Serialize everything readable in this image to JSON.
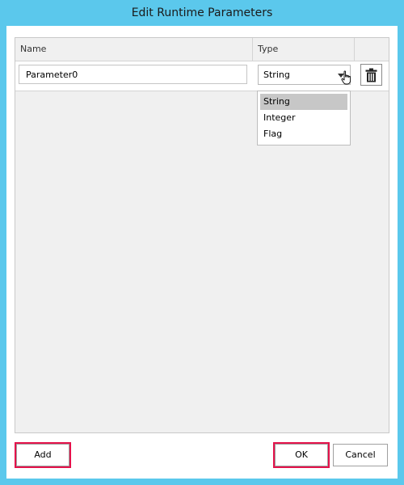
{
  "window": {
    "title": "Edit Runtime Parameters"
  },
  "grid": {
    "columns": {
      "name": "Name",
      "type": "Type"
    },
    "rows": [
      {
        "name": "Parameter0",
        "type": "String"
      }
    ]
  },
  "type_dropdown": {
    "options": [
      "String",
      "Integer",
      "Flag"
    ],
    "selected": "String"
  },
  "buttons": {
    "add": "Add",
    "ok": "OK",
    "cancel": "Cancel"
  },
  "colors": {
    "title_bar": "#5bc8ec",
    "highlight_box": "#e4124b",
    "selected_option": "#c7c7c7"
  },
  "icons": {
    "delete_row": "trash-icon",
    "dropdown": "chevron-down-icon",
    "pointer": "hand-cursor-icon"
  }
}
